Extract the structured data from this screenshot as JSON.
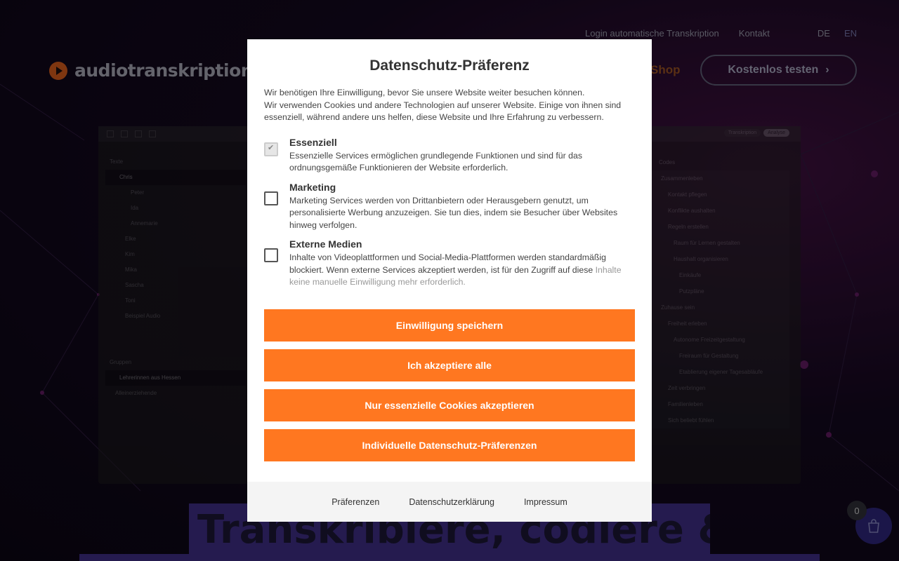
{
  "background": {
    "top_nav": {
      "login": "Login automatische Transkription",
      "contact": "Kontakt",
      "languages": [
        "DE",
        "EN"
      ]
    },
    "logo": "audiotranskription",
    "shop": "Shop",
    "cta": "Kostenlos testen",
    "app_preview": {
      "tabs": [
        "Transkription",
        "Analyse"
      ],
      "left_panel_title": "Texte",
      "texts": [
        "Chris",
        "Peter",
        "Ida",
        "Annemarie",
        "Elke",
        "Kim",
        "Mika",
        "Sascha",
        "Toni",
        "Beispiel Audio"
      ],
      "groups_title": "Gruppen",
      "groups": [
        "Lehrerinnen aus Hessen",
        "Alleinerziehende"
      ],
      "right_panel_title": "Codes",
      "codes": [
        "Zusammenleben",
        "Kontakt pflegen",
        "Konflikte aushalten",
        "Regeln erstellen",
        "Raum für Lernen gestalten",
        "Haushalt organisieren",
        "Einkäufe",
        "Putzpläne",
        "Zuhause sein",
        "Freiheit erleben",
        "Autonome Freizeitgestaltung",
        "Freiraum für Gestaltung",
        "Etablierung eigener Tagesabläufe",
        "Zeit verbringen",
        "Familienleben",
        "Sich beliebt fühlen"
      ]
    },
    "hero_title": "Transkribiere, codiere &",
    "cart_count": "0"
  },
  "consent": {
    "title": "Datenschutz-Präferenz",
    "intro_line1": "Wir benötigen Ihre Einwilligung, bevor Sie unsere Website weiter besuchen können.",
    "intro_line2": "Wir verwenden Cookies und andere Technologien auf unserer Website. Einige von ihnen sind essenziell, während andere uns helfen, diese Website und Ihre Erfahrung zu verbessern.",
    "groups": [
      {
        "title": "Essenziell",
        "description": "Essenzielle Services ermöglichen grundlegende Funktionen und sind für das ordnungsgemäße Funktionieren der Website erforderlich.",
        "checked": true
      },
      {
        "title": "Marketing",
        "description": "Marketing Services werden von Drittanbietern oder Herausgebern genutzt, um personalisierte Werbung anzuzeigen. Sie tun dies, indem sie Besucher über Websites hinweg verfolgen.",
        "checked": false
      },
      {
        "title": "Externe Medien",
        "description": "Inhalte von Videoplattformen und Social-Media-Plattformen werden standardmäßig blockiert. Wenn externe Services akzeptiert werden, ist für den Zugriff auf diese",
        "description_faded": "Inhalte keine manuelle Einwilligung mehr erforderlich.",
        "checked": false
      }
    ],
    "buttons": {
      "save": "Einwilligung speichern",
      "accept_all": "Ich akzeptiere alle",
      "essential_only": "Nur essenzielle Cookies akzeptieren",
      "individual": "Individuelle Datenschutz-Präferenzen"
    },
    "footer": {
      "preferences": "Präferenzen",
      "privacy": "Datenschutzerklärung",
      "imprint": "Impressum"
    },
    "colors": {
      "button": "#ff7720",
      "footer_bg": "#f4f4f4"
    }
  }
}
